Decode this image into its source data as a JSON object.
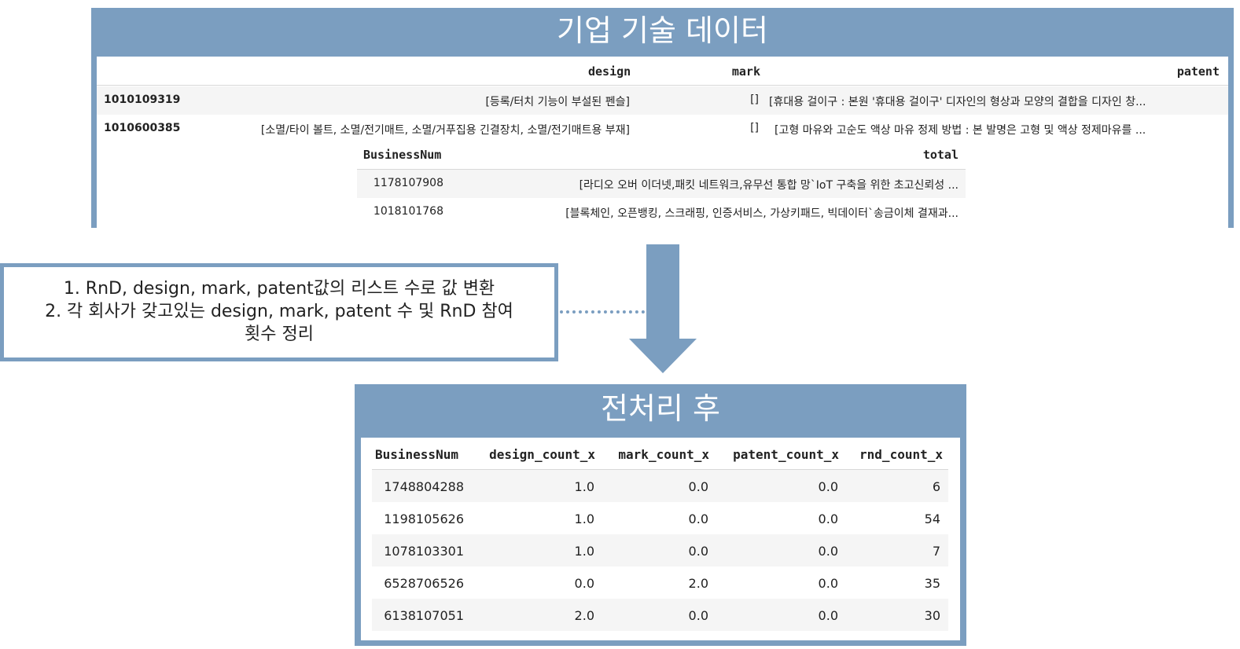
{
  "top_panel": {
    "title": "기업 기술 데이터",
    "table1": {
      "headers": {
        "design": "design",
        "mark": "mark",
        "patent": "patent"
      },
      "rows": [
        {
          "index": "1010109319",
          "design": "[등록/터치 기능이 부설된 펜슬]",
          "mark": "[]",
          "patent": "[휴대용 걸이구 : 본원 '휴대용 걸이구' 디자인의 형상과 모양의 결합을 디자인 창..."
        },
        {
          "index": "1010600385",
          "design": "[소멸/타이 볼트, 소멸/전기매트, 소멸/거푸집용 긴결장치, 소멸/전기매트용 부재]",
          "mark": "[]",
          "patent": "[고형 마유와 고순도 액상 마유 정제 방법 : 본 발명은 고형 및 액상 정제마유를 ..."
        }
      ]
    },
    "table2": {
      "headers": {
        "business_num": "BusinessNum",
        "total": "total"
      },
      "rows": [
        {
          "business_num": "1178107908",
          "total": "[라디오 오버 이더넷,패킷 네트워크,유무선 통합 망`IoT 구축을 위한 초고신뢰성 ..."
        },
        {
          "business_num": "1018101768",
          "total": "[블록체인, 오픈뱅킹, 스크래핑, 인증서비스, 가상키패드, 빅데이터`송금이체 결재과..."
        }
      ]
    }
  },
  "note": {
    "line1": "1. RnD, design, mark, patent값의 리스트 수로 값 변환",
    "line2": "2. 각 회사가 갖고있는 design, mark, patent 수 및 RnD 참여",
    "line3": "횟수 정리"
  },
  "bottom_panel": {
    "title": "전처리 후",
    "headers": [
      "BusinessNum",
      "design_count_x",
      "mark_count_x",
      "patent_count_x",
      "rnd_count_x"
    ],
    "rows": [
      [
        "1748804288",
        "1.0",
        "0.0",
        "0.0",
        "6"
      ],
      [
        "1198105626",
        "1.0",
        "0.0",
        "0.0",
        "54"
      ],
      [
        "1078103301",
        "1.0",
        "0.0",
        "0.0",
        "7"
      ],
      [
        "6528706526",
        "0.0",
        "2.0",
        "0.0",
        "35"
      ],
      [
        "6138107051",
        "2.0",
        "0.0",
        "0.0",
        "30"
      ]
    ]
  },
  "colors": {
    "panel": "#7b9ec0",
    "row_stripe": "#f5f5f5",
    "header_line": "#d8d8d8"
  }
}
